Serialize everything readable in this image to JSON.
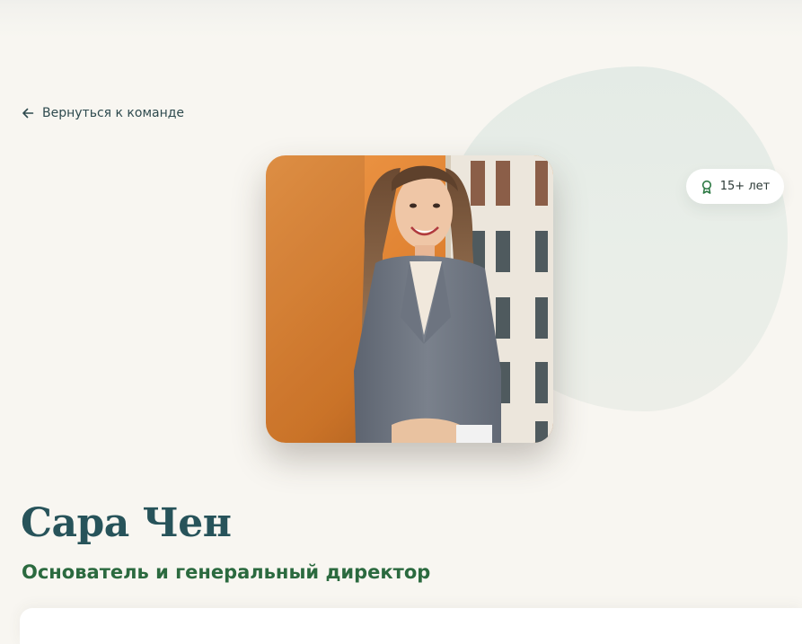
{
  "nav": {
    "back_label": "Вернуться к команде",
    "back_icon": "arrow-left-icon"
  },
  "badge": {
    "icon": "award-ribbon-icon",
    "label": "15+ лет"
  },
  "profile": {
    "name": "Сара Чен",
    "role": "Основатель и генеральный директор",
    "photo_desc_icon": "portrait-photo"
  },
  "colors": {
    "background": "#f8f6f1",
    "blob": "#e6ece7",
    "name": "#27535a",
    "role": "#2b6a3f",
    "badge_icon": "#2e7a45",
    "link": "#2e4a4e"
  }
}
